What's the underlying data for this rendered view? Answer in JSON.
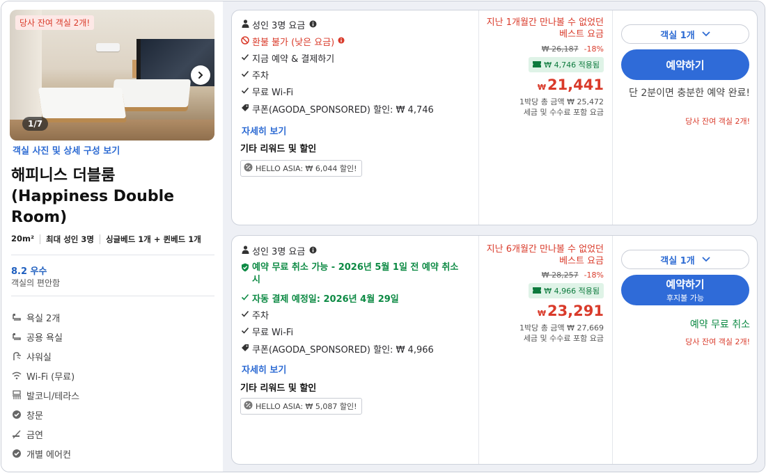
{
  "room": {
    "urgency_badge": "당사 잔여 객실 2개!",
    "photo_counter": "1/7",
    "photo_link": "객실 사진 및 상세 구성 보기",
    "title": "해피니스 더블룸 (Happiness Double Room)",
    "specs": [
      "20m²",
      "최대 성인 3명",
      "싱글베드 1개 + 퀸베드 1개"
    ],
    "score": "8.2 우수",
    "score_sub": "객실의 편안함",
    "amenities": [
      {
        "icon": "bath-icon",
        "label": "욕실 2개"
      },
      {
        "icon": "bath-icon",
        "label": "공용 욕실"
      },
      {
        "icon": "shower-icon",
        "label": "샤워실"
      },
      {
        "icon": "wifi-icon",
        "label": "Wi-Fi (무료)"
      },
      {
        "icon": "balcony-icon",
        "label": "발코니/테라스"
      },
      {
        "icon": "check-circle-icon",
        "label": "창문"
      },
      {
        "icon": "no-smoking-icon",
        "label": "금연"
      },
      {
        "icon": "check-circle-icon",
        "label": "개별 에어컨"
      }
    ]
  },
  "offers": [
    {
      "occupancy": "성인 3명 요금",
      "policy": "환불 불가 (낮은 요금)",
      "details": [
        "지금 예약 & 결제하기",
        "주차",
        "무료 Wi-Fi"
      ],
      "coupon": "쿠폰(AGODA_SPONSORED) 할인: ₩ 4,746",
      "more": "자세히 보기",
      "other_title": "기타 리워드 및 할인",
      "chip": "HELLO ASIA: ₩ 6,044 할인!",
      "promo": "지난 1개월간 만나볼 수 없었던 베스트 요금",
      "old_price": "₩ 26,187",
      "discount_pct": "-18%",
      "applied": "₩ 4,746 적용됨",
      "currency": "₩",
      "price": "21,441",
      "total": "1박당 총 금액 ₩ 25,472",
      "tax_note": "세금 및 수수료 포함 요금",
      "rooms_select": "객실 1개",
      "book_label": "예약하기",
      "note": "단 2분이면 충분한 예약 완료!",
      "remaining": "당사 잔여 객실 2개!"
    },
    {
      "occupancy": "성인 3명 요금",
      "policy": "예약 무료 취소 가능 - 2026년 5월 1일 전 예약 취소 시",
      "autopay": "자동 결제 예정일: 2026년 4월 29일",
      "details": [
        "주차",
        "무료 Wi-Fi"
      ],
      "coupon": "쿠폰(AGODA_SPONSORED) 할인: ₩ 4,966",
      "more": "자세히 보기",
      "other_title": "기타 리워드 및 할인",
      "chip": "HELLO ASIA: ₩ 5,087 할인!",
      "promo": "지난 6개월간 만나볼 수 없었던 베스트 요금",
      "old_price": "₩ 28,257",
      "discount_pct": "-18%",
      "applied": "₩ 4,966 적용됨",
      "currency": "₩",
      "price": "23,291",
      "total": "1박당 총 금액 ₩ 27,669",
      "tax_note": "세금 및 수수료 포함 요금",
      "rooms_select": "객실 1개",
      "book_label": "예약하기",
      "book_sub": "후지불 가능",
      "note": "예약 무료 취소",
      "remaining": "당사 잔여 객실 2개!"
    }
  ],
  "colors": {
    "accent": "#2f6bd8",
    "price_red": "#d93a2a",
    "green": "#0d8a44"
  }
}
